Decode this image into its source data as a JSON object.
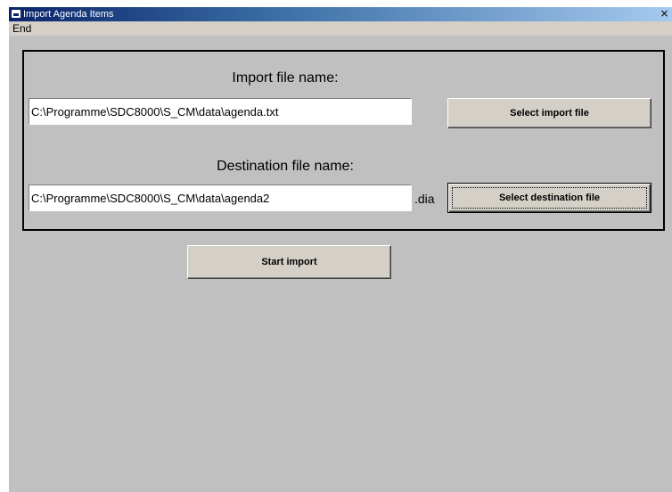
{
  "window": {
    "title": "Import Agenda Items",
    "close_glyph": "×"
  },
  "menu": {
    "items": [
      {
        "label": "End"
      }
    ]
  },
  "import": {
    "heading": "Import file name:",
    "file_value": "C:\\Programme\\SDC8000\\S_CM\\data\\agenda.txt",
    "select_button": "Select import file"
  },
  "destination": {
    "heading": "Destination file name:",
    "file_value": "C:\\Programme\\SDC8000\\S_CM\\data\\agenda2",
    "extension": ".dia",
    "select_button": "Select destination file"
  },
  "actions": {
    "start_import": "Start import"
  }
}
